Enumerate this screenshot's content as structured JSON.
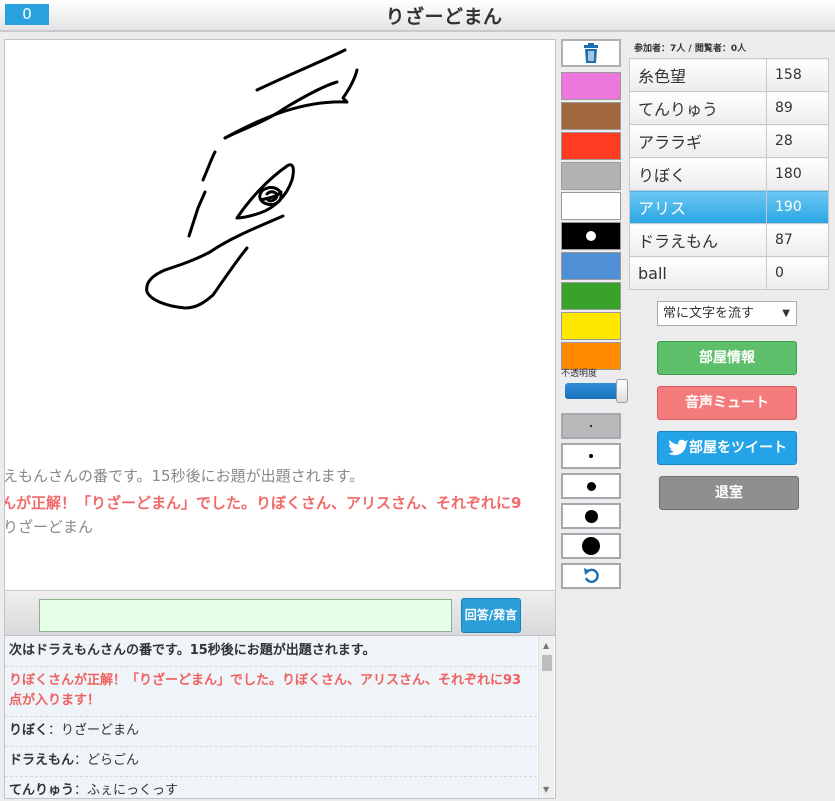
{
  "header": {
    "timer": "0",
    "title": "りざーどまん"
  },
  "canvas_overlay": [
    "えもんさんの番です。15秒後にお題が出題されます。",
    "んが正解！「りざーどまん」でした。りぼくさん、アリスさん、それぞれに9",
    "りざーどまん"
  ],
  "input": {
    "value": "",
    "button_label": "回答/発言"
  },
  "log": [
    {
      "type": "system",
      "text": "次はドラえもんさんの番です。15秒後にお題が出題されます。"
    },
    {
      "type": "correct",
      "text": "りぼくさんが正解！「りざーどまん」でした。りぼくさん、アリスさん、それぞれに93点が入ります！"
    },
    {
      "type": "chat",
      "who": "りぼく",
      "sep": "：",
      "text": "りざーどまん"
    },
    {
      "type": "chat",
      "who": "ドラえもん",
      "sep": "：",
      "text": "どらごん"
    },
    {
      "type": "chat",
      "who": "てんりゅう",
      "sep": "：",
      "text": "ふぇにっくっす"
    }
  ],
  "tools": {
    "trash_icon": "trash-icon",
    "colors": [
      "#ee77dd",
      "#a0683c",
      "#ff3b22",
      "#b2b2b2",
      "#ffffff",
      "#000000",
      "#4f8fd6",
      "#3aa22a",
      "#ffe800",
      "#ff8a00"
    ],
    "opacity_label": "不透明度",
    "opacity_value": 1.0,
    "undo_icon": "undo-icon"
  },
  "participants_text": "参加者：7人 / 閲覧者：0人",
  "scores": [
    {
      "name": "糸色望",
      "score": "158"
    },
    {
      "name": "てんりゅう",
      "score": "89"
    },
    {
      "name": "アララギ",
      "score": "28"
    },
    {
      "name": "りぼく",
      "score": "180"
    },
    {
      "name": "アリス",
      "score": "190"
    },
    {
      "name": "ドラえもん",
      "score": "87"
    },
    {
      "name": "ball",
      "score": "0"
    }
  ],
  "scroll_mode": {
    "selected": "常に文字を流す"
  },
  "buttons": {
    "room_info": "部屋情報",
    "mute": "音声ミュート",
    "tweet": "部屋をツイート",
    "exit": "退室"
  }
}
